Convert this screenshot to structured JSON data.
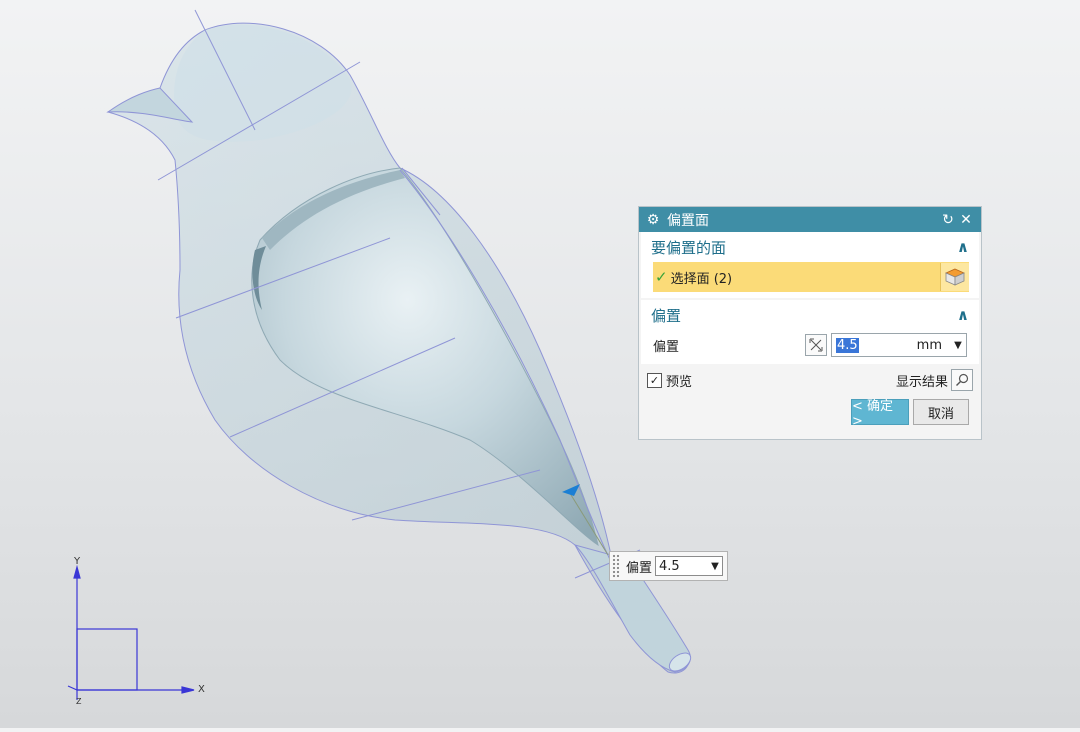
{
  "dialog": {
    "title": "偏置面",
    "section_faces": {
      "heading": "要偏置的面",
      "select_label": "选择面 (2)"
    },
    "section_offset": {
      "heading": "偏置",
      "field_label": "偏置",
      "value": "4.5",
      "unit": "mm"
    },
    "preview_label": "预览",
    "preview_checked": true,
    "show_result_label": "显示结果",
    "ok_label": "< 确定 >",
    "cancel_label": "取消"
  },
  "handle": {
    "label": "偏置",
    "value": "4.5"
  },
  "axes": {
    "x": "X",
    "y": "Y",
    "z": "Z"
  },
  "colors": {
    "title_bar": "#3f8ea6",
    "selection_highlight": "#fbdb78",
    "ok_button": "#5fb6d2",
    "model_surface": "#b9cfd8"
  },
  "icons": {
    "title": "gear-icon",
    "reset": "reset-icon",
    "close": "close-icon",
    "select_face": "face-select-icon",
    "scale": "scale-icon",
    "show_result": "magnifier-icon",
    "handle_arrow": "direction-arrow-icon"
  }
}
